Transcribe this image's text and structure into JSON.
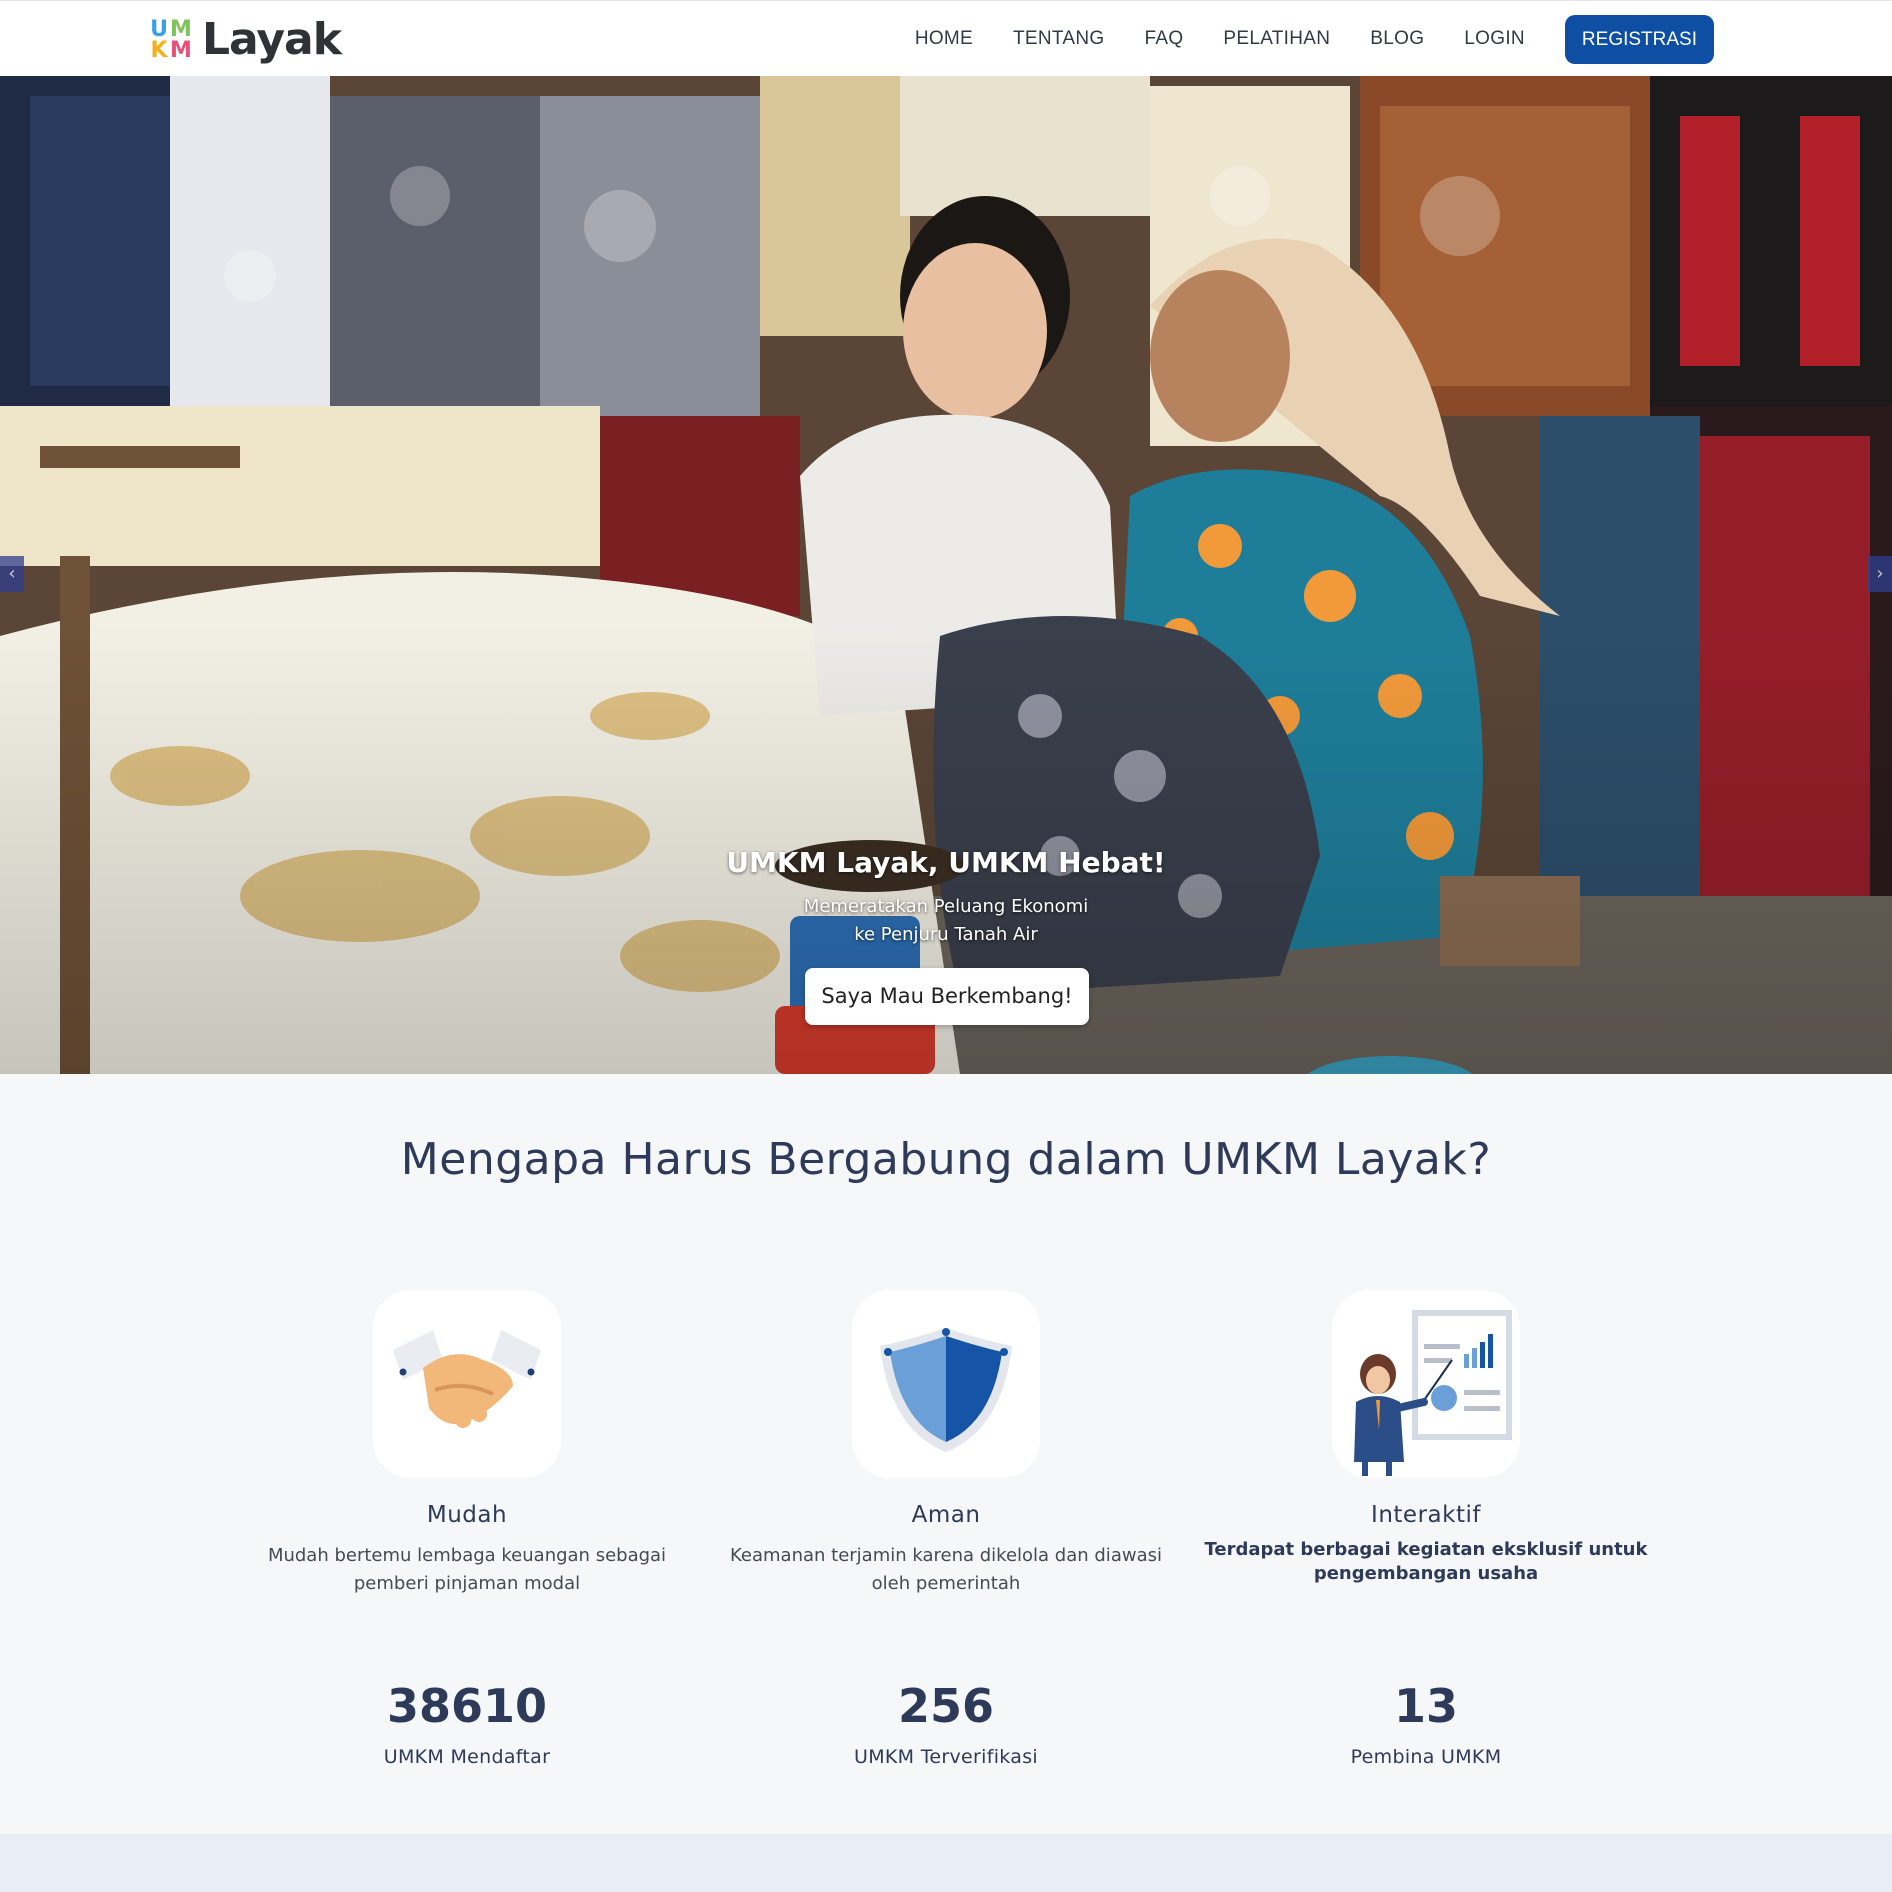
{
  "header": {
    "logo_letters": [
      "U",
      "M",
      "K",
      "M"
    ],
    "logo_text": "Layak",
    "nav": [
      {
        "label": "HOME"
      },
      {
        "label": "TENTANG"
      },
      {
        "label": "FAQ"
      },
      {
        "label": "PELATIHAN"
      },
      {
        "label": "BLOG"
      },
      {
        "label": "LOGIN"
      }
    ],
    "cta_label": "REGISTRASI"
  },
  "hero": {
    "title": "UMKM Layak, UMKM Hebat!",
    "subtitle_line1": "Memeratakan Peluang Ekonomi",
    "subtitle_line2": "ke Penjuru Tanah Air",
    "button_label": "Saya Mau Berkembang!",
    "prev_icon": "‹",
    "next_icon": "›"
  },
  "why": {
    "title": "Mengapa Harus Bergabung dalam UMKM Layak?",
    "features": [
      {
        "icon": "handshake-icon",
        "name": "Mudah",
        "desc": "Mudah bertemu lembaga keuangan sebagai pemberi pinjaman modal"
      },
      {
        "icon": "shield-icon",
        "name": "Aman",
        "desc": "Keamanan terjamin karena dikelola dan diawasi oleh pemerintah"
      },
      {
        "icon": "presentation-icon",
        "name": "Interaktif",
        "desc": "Terdapat berbagai kegiatan eksklusif untuk pengembangan usaha"
      }
    ],
    "stats": [
      {
        "value": "38610",
        "label": "UMKM Mendaftar"
      },
      {
        "value": "256",
        "label": "UMKM Terverifikasi"
      },
      {
        "value": "13",
        "label": "Pembina UMKM"
      }
    ]
  },
  "colors": {
    "brand": "#0e4fa3",
    "heading": "#2e3a59",
    "background": "#f6f7f9"
  }
}
